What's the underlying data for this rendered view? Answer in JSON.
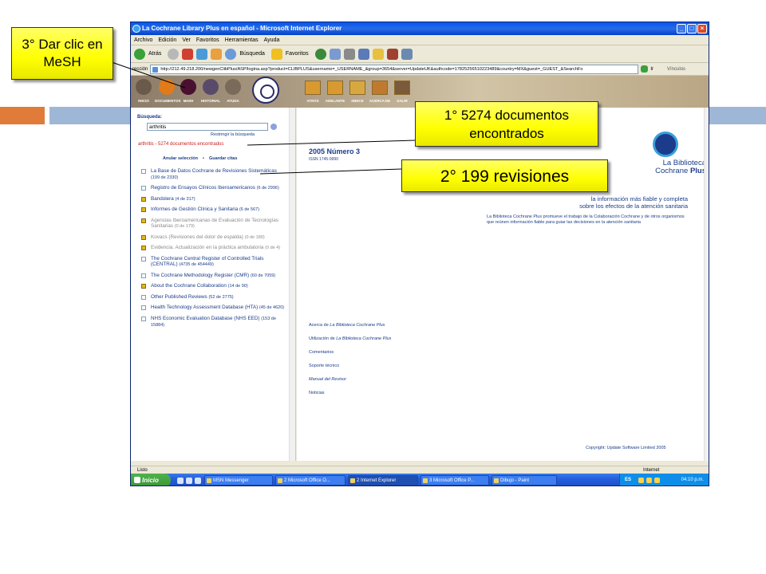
{
  "window": {
    "title": "La Cochrane Library Plus en español - Microsoft Internet Explorer",
    "controls": [
      "_",
      "□",
      "×"
    ]
  },
  "menu": [
    "Archivo",
    "Edición",
    "Ver",
    "Favoritos",
    "Herramientas",
    "Ayuda"
  ],
  "toolbar": {
    "back_label": "Atrás",
    "search_label": "Búsqueda",
    "favorites_label": "Favoritos"
  },
  "address": {
    "label": "rección",
    "url": "http://212.49.218.200/newgenClibPlus/ASP/logina.asp?product=CLIBPLUS&username=_USERNAME_&group=3654&server=UpdateUK&authcode=17825256510223489&country=MX&guest=_GUEST_&SearchFo",
    "go_label": "Ir",
    "links_label": "Vínculos"
  },
  "sitenav": {
    "left": [
      "INICIO",
      "DOCUMENTOS",
      "MeSH",
      "HISTORIAL",
      "AYUDA"
    ],
    "right": [
      "ATRÁS",
      "ADELANTE",
      "INDICE",
      "ACERCA DE",
      "SALIR"
    ],
    "left_colors": [
      "#6b5a4a",
      "#e07a1a",
      "#4a1030",
      "#5a4a6a",
      "#7a6a5a"
    ],
    "right_colors": [
      "#d89a30",
      "#d89a30",
      "#d8a840",
      "#c07a30",
      "#7a5a3a"
    ]
  },
  "search": {
    "label": "Búsqueda:",
    "query": "arthritis",
    "restrict": "Restringir la búsqueda",
    "results": "arthritis - 5274 documentos encontrados",
    "clear_label": "Anular selección",
    "separator": "•",
    "save_label": "Guardar citas"
  },
  "databases": [
    {
      "name": "La Base de Datos Cochrane de Revisiones Sistemáticas",
      "count": "(199 de 2330)",
      "icon": "checkbox",
      "dim": false
    },
    {
      "name": "Registro de Ensayos Clínicos Iberoamericanos",
      "count": "(6 de 2996)",
      "icon": "checkbox",
      "dim": false
    },
    {
      "name": "Bandolera",
      "count": "(4 de 317)",
      "icon": "cube",
      "dim": false
    },
    {
      "name": "Informes de Gestión Clínica y Sanitaria",
      "count": "(6 de 567)",
      "icon": "cube",
      "dim": false
    },
    {
      "name": "Agencias Iberoamericanas de Evaluación de Tecnologías Sanitarias",
      "count": "(0 de 179)",
      "icon": "cube",
      "dim": true
    },
    {
      "name": "Kovacs (Revisiones del dolor de espalda)",
      "count": "(0 de 189)",
      "icon": "cube",
      "dim": true
    },
    {
      "name": "Evidencia. Actualización en la práctica ambulatoria",
      "count": "(0 de 4)",
      "icon": "cube",
      "dim": true
    },
    {
      "name": "The Cochrane Central Register of Controlled Trials (CENTRAL)",
      "count": "(4735 de 454449)",
      "icon": "checkbox",
      "dim": false
    },
    {
      "name": "The Cochrane Methodology Register (CMR)",
      "count": "(60 de 7059)",
      "icon": "checkbox",
      "dim": false
    },
    {
      "name": "About the Cochrane Collaboration",
      "count": "(14 de 90)",
      "icon": "cube",
      "dim": false
    },
    {
      "name": "Other Published Reviews",
      "count": "(52 de 2775)",
      "icon": "checkbox",
      "dim": false
    },
    {
      "name": "Health Technology Assessment Database (HTA)",
      "count": "(45 de 4620)",
      "icon": "checkbox",
      "dim": false
    },
    {
      "name": "NHS Economic Evaluation Database (NHS EED)",
      "count": "(153 de 15884)",
      "icon": "checkbox",
      "dim": false
    }
  ],
  "issue": {
    "title": "2005 Número 3",
    "issn": "ISSN 1745-9990"
  },
  "brand": {
    "line1": "La Biblioteca",
    "line2": "Cochrane",
    "line3": "Plus"
  },
  "tagline": {
    "line1": "la información más fiable y completa",
    "line2": "sobre los efectos de la atención sanitaria"
  },
  "description": "La Biblioteca Cochrane Plus promueve el trabajo de la Colaboración Cochrane y de otros organismos que reúnen información fiable para guiar las decisiones en la atención sanitaria",
  "links": {
    "about_prefix": "Acerca de ",
    "about_italic": "La Biblioteca Cochrane Plus",
    "use_prefix": "Utilización de ",
    "use_italic": "La Biblioteca Cochrane Plus",
    "comments": "Comentarios",
    "support": "Soporte técnico",
    "manual": "Manual del Revisor",
    "news": "Noticias"
  },
  "copyright": "Copyright: Update Software Limited 2005",
  "status": {
    "text": "Listo",
    "zone": "Internet"
  },
  "taskbar": {
    "start": "Inicio",
    "tasks": [
      "MSN Messenger",
      "2 Microsoft Office O...",
      "2 Internet Explorer",
      "3 Microsoft Office P...",
      "Dibujo - Paint"
    ],
    "lang": "ES",
    "clock": "04:10 p.m."
  },
  "callouts": {
    "step3": "3° Dar clic en MeSH",
    "step1": "1° 5274 documentos encontrados",
    "step2": "2° 199 revisiones"
  },
  "colors": {
    "callout": "#ffff00",
    "accent_orange": "#e07b3a",
    "accent_blue": "#9fb7d6",
    "link_blue": "#1a3c8a",
    "result_red": "#c81c1c"
  }
}
